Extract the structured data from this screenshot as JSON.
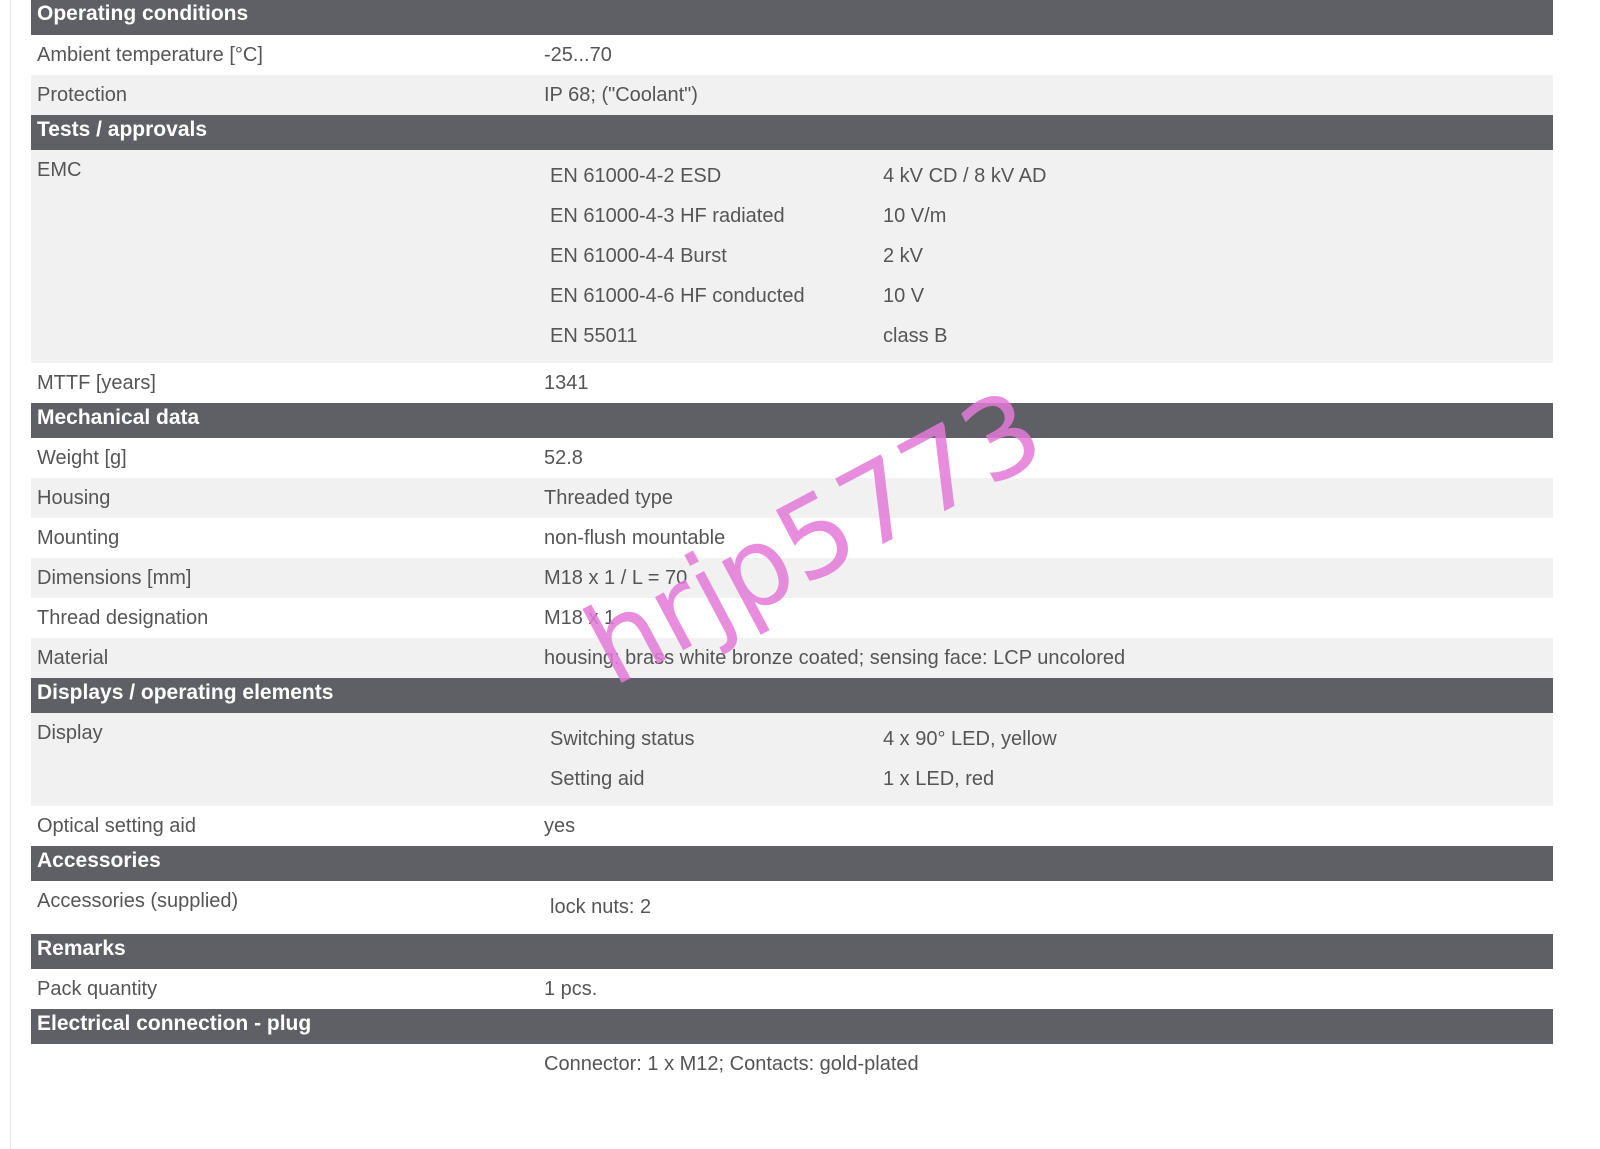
{
  "sections": {
    "operating": {
      "title": "Operating conditions",
      "rows": [
        {
          "label": "Ambient temperature [°C]",
          "value": "-25...70"
        },
        {
          "label": "Protection",
          "value": "IP 68; (\"Coolant\")"
        }
      ]
    },
    "tests": {
      "title": "Tests / approvals",
      "emc": {
        "label": "EMC",
        "items": [
          {
            "name": "EN 61000-4-2 ESD",
            "value": "4 kV CD / 8 kV AD"
          },
          {
            "name": "EN 61000-4-3 HF radiated",
            "value": "10 V/m"
          },
          {
            "name": "EN 61000-4-4 Burst",
            "value": "2 kV"
          },
          {
            "name": "EN 61000-4-6 HF conducted",
            "value": "10 V"
          },
          {
            "name": "EN 55011",
            "value": "class B"
          }
        ]
      },
      "mttf": {
        "label": "MTTF [years]",
        "value": "1341"
      }
    },
    "mechanical": {
      "title": "Mechanical data",
      "rows": [
        {
          "label": "Weight [g]",
          "value": "52.8"
        },
        {
          "label": "Housing",
          "value": "Threaded type"
        },
        {
          "label": "Mounting",
          "value": "non-flush mountable"
        },
        {
          "label": "Dimensions [mm]",
          "value": "M18 x 1 / L = 70"
        },
        {
          "label": "Thread designation",
          "value": "M18 x 1"
        },
        {
          "label": "Material",
          "value": "housing: brass white bronze coated; sensing face: LCP uncolored"
        }
      ]
    },
    "displays": {
      "title": "Displays / operating elements",
      "display": {
        "label": "Display",
        "items": [
          {
            "name": "Switching status",
            "value": "4 x 90° LED, yellow"
          },
          {
            "name": "Setting aid",
            "value": "1 x LED, red"
          }
        ]
      },
      "optical": {
        "label": "Optical setting aid",
        "value": "yes"
      }
    },
    "accessories": {
      "title": "Accessories",
      "supplied": {
        "label": "Accessories (supplied)",
        "value": "lock nuts: 2"
      }
    },
    "remarks": {
      "title": "Remarks",
      "pack": {
        "label": "Pack quantity",
        "value": "1 pcs."
      }
    },
    "electrical": {
      "title": "Electrical connection - plug",
      "connector": {
        "label": "",
        "value": "Connector: 1 x M12; Contacts: gold-plated"
      }
    }
  },
  "watermark": "hrjp5773",
  "colors": {
    "header_bg": "#5f6066",
    "row_alt_bg": "#f1f1f1",
    "text": "#555555",
    "watermark": "#e47ad8"
  }
}
